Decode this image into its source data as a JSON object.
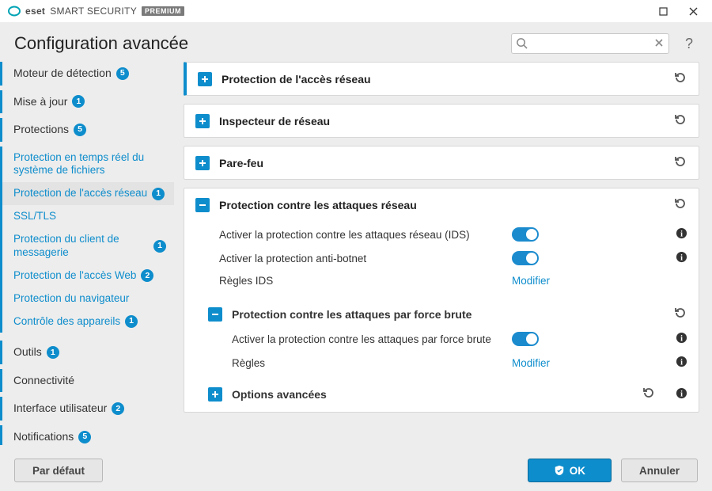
{
  "window": {
    "brand_prefix": "eset",
    "brand_product": "SMART SECURITY",
    "brand_tier": "PREMIUM"
  },
  "page_title": "Configuration avancée",
  "search": {
    "placeholder": ""
  },
  "help_label": "?",
  "sidebar": [
    {
      "kind": "item",
      "label": "Moteur de détection",
      "badge": "5"
    },
    {
      "kind": "item",
      "label": "Mise à jour",
      "badge": "1"
    },
    {
      "kind": "item",
      "label": "Protections",
      "badge": "5"
    },
    {
      "kind": "sub",
      "label": "Protection en temps réel du système de fichiers",
      "badge": ""
    },
    {
      "kind": "sub",
      "label": "Protection de l'accès réseau",
      "badge": "1",
      "active": true
    },
    {
      "kind": "sub",
      "label": "SSL/TLS",
      "badge": ""
    },
    {
      "kind": "sub",
      "label": "Protection du client de messagerie",
      "badge": "1"
    },
    {
      "kind": "sub",
      "label": "Protection de l'accès Web",
      "badge": "2"
    },
    {
      "kind": "sub",
      "label": "Protection du navigateur",
      "badge": ""
    },
    {
      "kind": "sub",
      "label": "Contrôle des appareils",
      "badge": "1"
    },
    {
      "kind": "item",
      "label": "Outils",
      "badge": "1"
    },
    {
      "kind": "item",
      "label": "Connectivité",
      "badge": ""
    },
    {
      "kind": "item",
      "label": "Interface utilisateur",
      "badge": "2"
    },
    {
      "kind": "item",
      "label": "Notifications",
      "badge": "5"
    }
  ],
  "panels": {
    "p0": {
      "title": "Protection de l'accès réseau"
    },
    "p1": {
      "title": "Inspecteur de réseau"
    },
    "p2": {
      "title": "Pare-feu"
    },
    "p3": {
      "title": "Protection contre les attaques réseau",
      "rows": {
        "r0": {
          "label": "Activer la protection contre les attaques réseau (IDS)"
        },
        "r1": {
          "label": "Activer la protection anti-botnet"
        },
        "r2": {
          "label": "Règles IDS",
          "action": "Modifier"
        }
      },
      "sub": {
        "title": "Protection contre les attaques par force brute",
        "rows": {
          "s0": {
            "label": "Activer la protection contre les attaques par force brute"
          },
          "s1": {
            "label": "Règles",
            "action": "Modifier"
          }
        }
      },
      "adv": {
        "title": "Options avancées"
      }
    }
  },
  "footer": {
    "default": "Par défaut",
    "ok": "OK",
    "cancel": "Annuler"
  }
}
